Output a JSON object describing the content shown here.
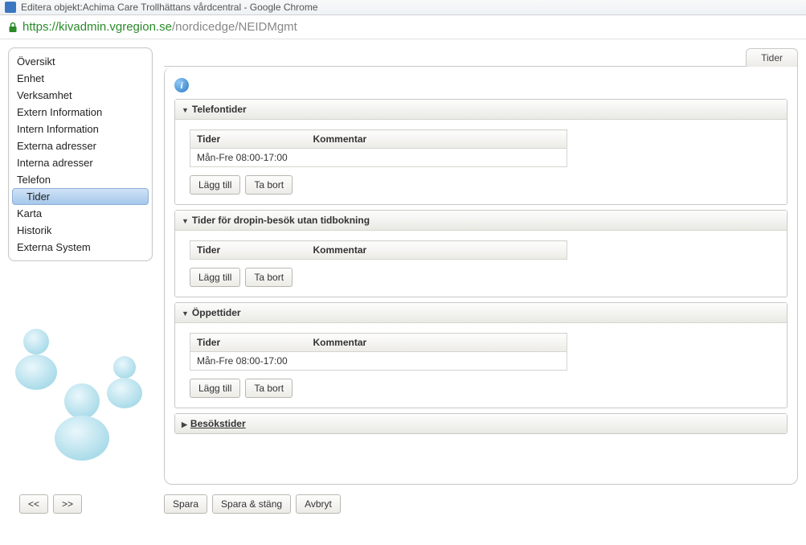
{
  "window": {
    "title": "Editera objekt:Achima Care Trollhättans vårdcentral - Google Chrome"
  },
  "url": {
    "secure": "https://kivadmin.vgregion.se",
    "path": "/nordicedge/NEIDMgmt"
  },
  "sidebar": {
    "items": [
      {
        "label": "Översikt"
      },
      {
        "label": "Enhet"
      },
      {
        "label": "Verksamhet"
      },
      {
        "label": "Extern Information"
      },
      {
        "label": "Intern Information"
      },
      {
        "label": "Externa adresser"
      },
      {
        "label": "Interna adresser"
      },
      {
        "label": "Telefon"
      },
      {
        "label": "Tider",
        "sub": true,
        "selected": true
      },
      {
        "label": "Karta"
      },
      {
        "label": "Historik"
      },
      {
        "label": "Externa System"
      }
    ]
  },
  "tab": {
    "label": "Tider"
  },
  "sections": {
    "telefon": {
      "title": "Telefontider",
      "cols": {
        "tider": "Tider",
        "kommentar": "Kommentar"
      },
      "rows": [
        {
          "tider": "Mån-Fre 08:00-17:00",
          "kommentar": ""
        }
      ],
      "add": "Lägg till",
      "remove": "Ta bort"
    },
    "dropin": {
      "title": "Tider för dropin-besök utan tidbokning",
      "cols": {
        "tider": "Tider",
        "kommentar": "Kommentar"
      },
      "rows": [],
      "add": "Lägg till",
      "remove": "Ta bort"
    },
    "oppettider": {
      "title": "Öppettider",
      "cols": {
        "tider": "Tider",
        "kommentar": "Kommentar"
      },
      "rows": [
        {
          "tider": "Mån-Fre 08:00-17:00",
          "kommentar": ""
        }
      ],
      "add": "Lägg till",
      "remove": "Ta bort"
    },
    "besok": {
      "title": "Besökstider"
    }
  },
  "footer": {
    "prev": "<<",
    "next": ">>",
    "save": "Spara",
    "save_close": "Spara & stäng",
    "cancel": "Avbryt"
  }
}
